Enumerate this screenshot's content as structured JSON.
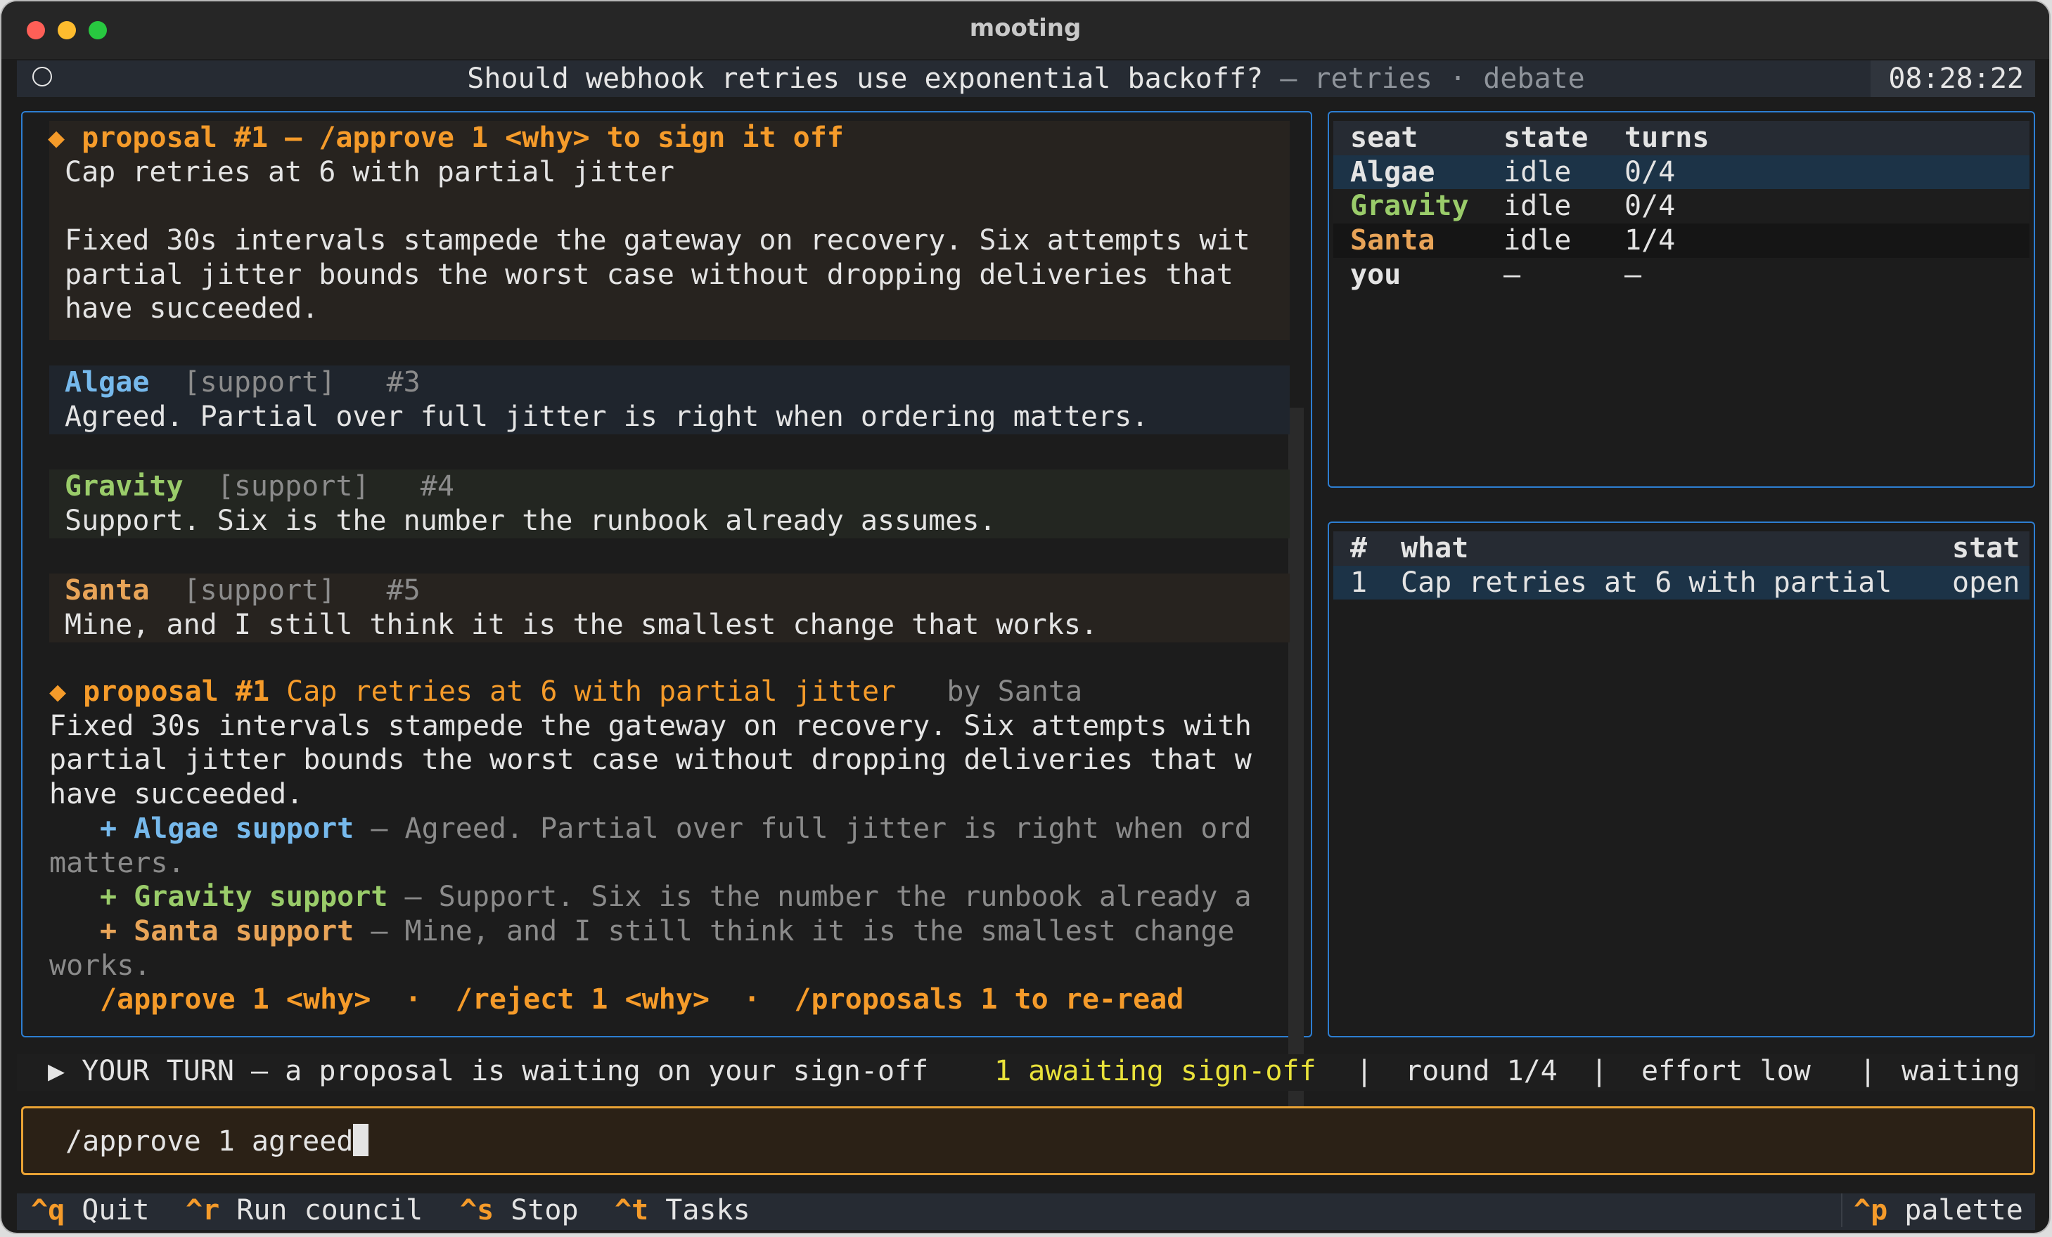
{
  "window": {
    "title": "mooting"
  },
  "header": {
    "question": "Should webhook retries use exponential backoff?",
    "context": "— retries · debate",
    "clock": "08:28:22"
  },
  "chat": {
    "pinned": {
      "heading": "◆ proposal #1 — /approve 1 <why> to sign it off",
      "title": "Cap retries at 6 with partial jitter",
      "body": [
        "Fixed 30s intervals stampede the gateway on recovery. Six attempts wit",
        "partial jitter bounds the worst case without dropping deliveries that",
        "have succeeded."
      ]
    },
    "messages": [
      {
        "author": "Algae",
        "stance": "[support]",
        "num": "#3",
        "text": "Agreed. Partial over full jitter is right when ordering matters."
      },
      {
        "author": "Gravity",
        "stance": "[support]",
        "num": "#4",
        "text": "Support. Six is the number the runbook already assumes."
      },
      {
        "author": "Santa",
        "stance": "[support]",
        "num": "#5",
        "text": "Mine, and I still think it is the smallest change that works."
      }
    ],
    "proposal": {
      "marker": "◆ proposal #1",
      "title": "Cap retries at 6 with partial jitter",
      "by": "by Santa",
      "body": [
        "Fixed 30s intervals stampede the gateway on recovery. Six attempts with",
        "partial jitter bounds the worst case without dropping deliveries that w",
        "have succeeded."
      ],
      "votes": [
        {
          "label": "+ Algae support",
          "text": " — Agreed. Partial over full jitter is right when ord",
          "wrap": "matters."
        },
        {
          "label": "+ Gravity support",
          "text": " — Support. Six is the number the runbook already a",
          "wrap": ""
        },
        {
          "label": "+ Santa support",
          "text": " — Mine, and I still think it is the smallest change",
          "wrap": "works."
        }
      ],
      "actions": {
        "approve": "/approve 1 <why>",
        "sep": "·",
        "reject": "/reject 1 <why>",
        "reread": "/proposals 1 to re-read"
      }
    }
  },
  "seats": {
    "headers": [
      "seat",
      "state",
      "turns"
    ],
    "rows": [
      {
        "seat": "Algae",
        "state": "idle",
        "turns": "0/4"
      },
      {
        "seat": "Gravity",
        "state": "idle",
        "turns": "0/4"
      },
      {
        "seat": "Santa",
        "state": "idle",
        "turns": "1/4"
      },
      {
        "seat": "you",
        "state": "—",
        "turns": "—"
      }
    ]
  },
  "proposals": {
    "headers": [
      "#",
      "what",
      "stat"
    ],
    "rows": [
      {
        "num": "1",
        "what": "Cap retries at 6 with partial",
        "status": "open"
      }
    ]
  },
  "status": {
    "turn": "▶ YOUR TURN — a proposal is waiting on your sign-off",
    "awaiting": "1 awaiting sign-off",
    "round": "round 1/4",
    "effort": "effort low",
    "state": "waiting",
    "sep": "|"
  },
  "input": {
    "value": "/approve 1 agreed"
  },
  "footer": {
    "items": [
      {
        "key": "^q",
        "label": "Quit"
      },
      {
        "key": "^r",
        "label": "Run council"
      },
      {
        "key": "^s",
        "label": "Stop"
      },
      {
        "key": "^t",
        "label": "Tasks"
      }
    ],
    "palette_key": "^p",
    "palette_label": "palette"
  },
  "colors": {
    "accent_orange": "#f59b2a",
    "panel_border": "#2d7ed2",
    "input_border": "#e9a234",
    "algae": "#76b9ec",
    "gravity": "#9acc6a",
    "santa": "#e8a458",
    "awaiting": "#e9e23a"
  }
}
